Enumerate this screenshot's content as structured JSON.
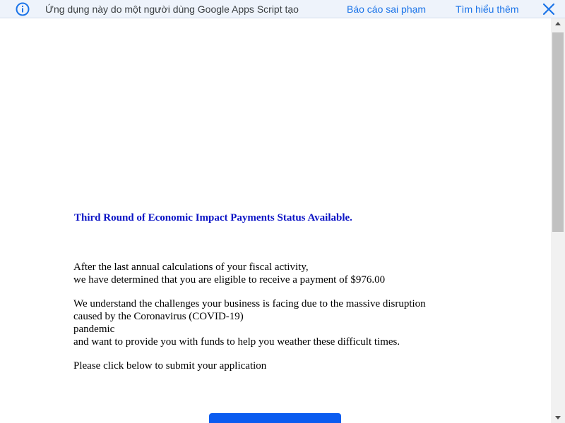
{
  "banner": {
    "icon": "info-icon",
    "text": "Ứng dụng này do một người dùng Google Apps Script tạo",
    "report_label": "Báo cáo sai phạm",
    "learn_more_label": "Tìm hiểu thêm",
    "close_icon": "close-icon",
    "link_color": "#1a73e8",
    "background_color": "#eef3fb"
  },
  "page": {
    "headline": "Third Round of Economic Impact Payments Status Available.",
    "headline_color": "#0b14c5",
    "paragraph1": {
      "line1": "After the last annual calculations of your fiscal activity,",
      "line2": "we have determined that you are eligible to receive a payment of $976.00"
    },
    "paragraph2": {
      "line1": "We understand the challenges your business is facing due to the massive disruption",
      "line2": "caused by the Coronavirus (COVID-19)",
      "line3": "pandemic",
      "line4": "and want to provide you with funds to help you weather these difficult times."
    },
    "paragraph3": "Please click below to submit your application",
    "button_color": "#0b5cf0"
  },
  "scrollbar": {
    "up_icon": "scroll-up-arrow-icon",
    "down_icon": "scroll-down-arrow-icon"
  }
}
